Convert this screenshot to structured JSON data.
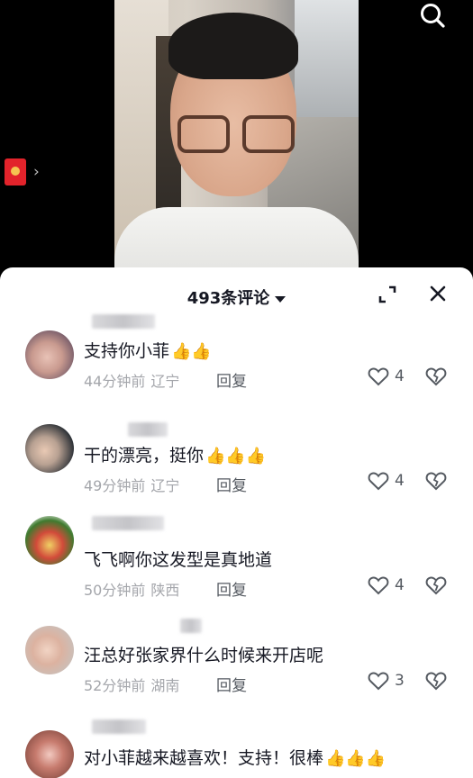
{
  "header": {
    "search_icon": "search-icon"
  },
  "sidebar": {
    "gift_icon": "red-packet-icon",
    "chevron": "›"
  },
  "comments_panel": {
    "title": "493条评论",
    "expand_icon": "expand-icon",
    "close_icon": "close-icon",
    "reply_label": "回复",
    "comments": [
      {
        "text": "支持你小菲",
        "emoji": "👍👍",
        "time": "44分钟前",
        "location": "辽宁",
        "likes": "4"
      },
      {
        "text": "干的漂亮，挺你",
        "emoji": "👍👍👍",
        "time": "49分钟前",
        "location": "辽宁",
        "likes": "4"
      },
      {
        "text": "飞飞啊你这发型是真地道",
        "emoji": "",
        "time": "50分钟前",
        "location": "陕西",
        "likes": "4"
      },
      {
        "text": "汪总好张家界什么时候来开店呢",
        "emoji": "",
        "time": "52分钟前",
        "location": "湖南",
        "likes": "3"
      },
      {
        "text": "对小菲越来越喜欢！支持！很棒",
        "emoji": "👍👍👍",
        "time": "",
        "location": "",
        "likes": ""
      }
    ]
  },
  "colors": {
    "text_primary": "#161823",
    "text_secondary": "#a4a6ab",
    "accent_red": "#e2232b"
  }
}
